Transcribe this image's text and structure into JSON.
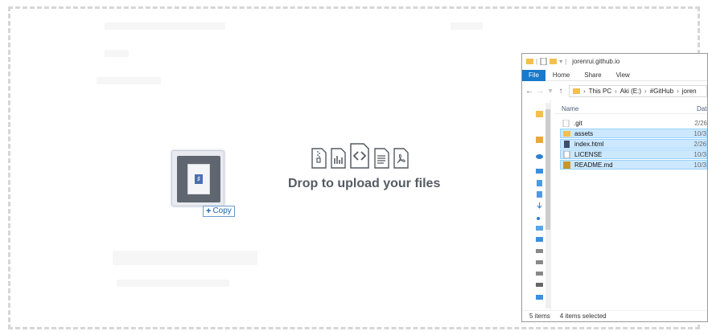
{
  "upload": {
    "prompt": "Drop to upload your files",
    "file_type_icons": [
      "zip-file-icon",
      "chart-file-icon",
      "code-file-icon",
      "text-file-icon",
      "pdf-file-icon"
    ],
    "drag_badge": "Copy"
  },
  "explorer": {
    "title": "jorenrui.github.io",
    "ribbon_tabs": [
      "File",
      "Home",
      "Share",
      "View"
    ],
    "breadcrumb": [
      "This PC",
      "Aki (E:)",
      "#GitHub",
      "joren"
    ],
    "columns": {
      "name": "Name",
      "date": "Date"
    },
    "files": [
      {
        "name": ".git",
        "date": "2/26",
        "icon": "folder-icon",
        "selected": false
      },
      {
        "name": "assets",
        "date": "10/3",
        "icon": "folder-icon",
        "selected": true
      },
      {
        "name": "index.html",
        "date": "2/26",
        "icon": "html-file-icon",
        "selected": true
      },
      {
        "name": "LICENSE",
        "date": "10/3",
        "icon": "file-icon",
        "selected": true
      },
      {
        "name": "README.md",
        "date": "10/3",
        "icon": "markdown-file-icon",
        "selected": true
      }
    ],
    "status": {
      "count": "5 items",
      "selection": "4 items selected"
    }
  },
  "colors": {
    "accent": "#1979ca",
    "selection": "#cce8ff",
    "folder": "#f4c04a",
    "text_main": "#555b63"
  }
}
